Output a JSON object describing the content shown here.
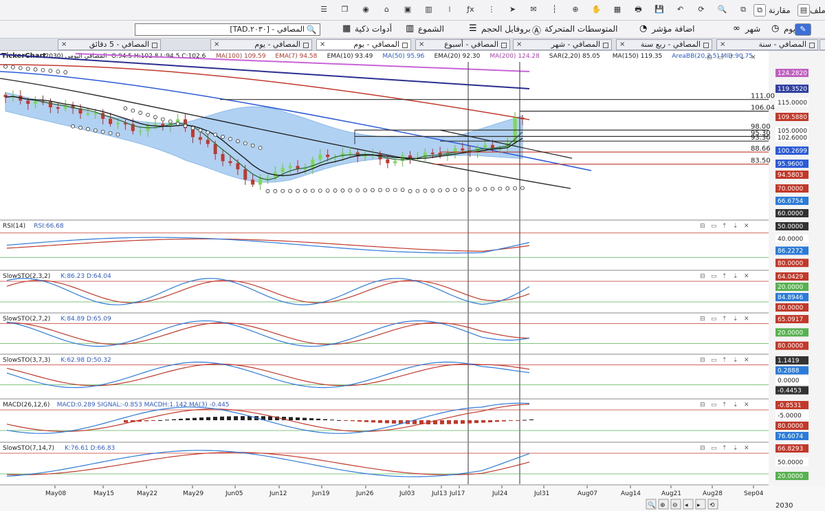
{
  "toolbar1": {
    "right_items": [
      {
        "label": "ملف",
        "icon": "file-icon"
      },
      {
        "label": "مقارنة",
        "icon": "compare-icon"
      }
    ],
    "icon_names": [
      "compare-alt-icon",
      "zoom-icon",
      "refresh-icon",
      "undo-icon",
      "save-icon",
      "print-icon",
      "layout-icon",
      "hand-icon",
      "crosshair-icon",
      "dotted-line-icon",
      "mail-icon",
      "pointer-icon",
      "dots-icon",
      "fx-icon",
      "signal-icon",
      "bar-chart-icon",
      "calendar-icon",
      "home-icon",
      "camera-icon",
      "copy-icon",
      "list-icon"
    ]
  },
  "toolbar2": {
    "items": [
      {
        "label": "يوم",
        "icon": "clock-icon"
      },
      {
        "label": "شهر",
        "icon": "glasses-icon"
      },
      {
        "label": "اضافة مؤشر",
        "icon": "add-indicator-icon"
      },
      {
        "label": "المتوسطات المتحركة",
        "icon": "ma-icon"
      },
      {
        "label": "بروفايل الحجم",
        "icon": "volume-profile-icon"
      },
      {
        "label": "الشموع",
        "icon": "candles-icon"
      },
      {
        "label": "أدوات ذكية",
        "icon": "smart-tools-icon"
      }
    ],
    "search_value": "[TAD.٢٠٣٠] - المصافي"
  },
  "tabs": [
    {
      "label": "المصافي - سنة",
      "active": false
    },
    {
      "label": "المصافي - ربع سنة",
      "active": false
    },
    {
      "label": "المصافي - شهر",
      "active": false
    },
    {
      "label": "المصافي - أسبوع",
      "active": false
    },
    {
      "label": "المصافي - يوم",
      "active": true
    },
    {
      "label": "المصافي - يوم",
      "active": false
    },
    {
      "label": "المصافي - 5 دقائق",
      "active": false
    }
  ],
  "main_header": {
    "title": "TickerChart",
    "symbol": "المصافي اليومي (2030)",
    "ohlc": "O:94.5 H:102.8 L:94.5 C:102.6",
    "indicators": [
      {
        "text": "MA(100)",
        "value": "109.59",
        "color": "#c0392b"
      },
      {
        "text": "EMA(7)",
        "value": "94.58",
        "color": "#c0392b"
      },
      {
        "text": "EMA(10)",
        "value": "93.49",
        "color": "#222222"
      },
      {
        "text": "MA(50)",
        "value": "95.96",
        "color": "#2d5bd8"
      },
      {
        "text": "EMA(20)",
        "value": "92.30",
        "color": "#222222"
      },
      {
        "text": "MA(200)",
        "value": "124.28",
        "color": "#c040c0"
      },
      {
        "text": "SAR(2,20)",
        "value": "85.05",
        "color": "#222222"
      },
      {
        "text": "MA(150)",
        "value": "119.35",
        "color": "#222222"
      },
      {
        "text": "AreaBB(20,2.5)",
        "value": "MID:90.75",
        "color": "#2d5bd8"
      }
    ]
  },
  "level_labels": [
    "111.00",
    "106.04",
    "98.00",
    "95.30",
    "93.30",
    "88.66",
    "83.50"
  ],
  "price_axis": [
    {
      "value": "124.2820",
      "bg": "#c060c0"
    },
    {
      "value": "119.3520",
      "bg": "#3040a0"
    },
    {
      "value": "115.0000",
      "bg": "#ffffff"
    },
    {
      "value": "109.5880",
      "bg": "#c0392b"
    },
    {
      "value": "105.0000",
      "bg": "#ffffff"
    },
    {
      "value": "102.6000",
      "bg": "#ffffff"
    },
    {
      "value": "100.2699",
      "bg": "#2d5bd8"
    },
    {
      "value": "95.9600",
      "bg": "#2d5bd8"
    },
    {
      "value": "94.5803",
      "bg": "#c0392b"
    },
    {
      "value": "70.0000",
      "bg": "#c0392b"
    },
    {
      "value": "66.6754",
      "bg": "#2d7bd8"
    },
    {
      "value": "60.0000",
      "bg": "#333333"
    }
  ],
  "panes": [
    {
      "name": "rsi-pane",
      "label": "RSI(14)",
      "values": "RSI:66.68",
      "axis": [
        {
          "value": "50.0000",
          "bg": "#333333"
        },
        {
          "value": "40.0000",
          "bg": "#ffffff"
        },
        {
          "value": "86.2272",
          "bg": "#2d7bd8"
        },
        {
          "value": "80.0000",
          "bg": "#c0392b"
        }
      ]
    },
    {
      "name": "slowsto-1-pane",
      "label": "SlowSTO(2,3,2)",
      "values": "K:86.23  D:64.04",
      "axis": [
        {
          "value": "64.0429",
          "bg": "#c0392b"
        },
        {
          "value": "20.0000",
          "bg": "#58b050"
        },
        {
          "value": "84.8946",
          "bg": "#2d7bd8"
        },
        {
          "value": "80.0000",
          "bg": "#c0392b"
        }
      ]
    },
    {
      "name": "slowsto-2-pane",
      "label": "SlowSTO(2,7,2)",
      "values": "K:84.89  D:65.09",
      "axis": [
        {
          "value": "65.0917",
          "bg": "#c0392b"
        },
        {
          "value": "20.0000",
          "bg": "#58b050"
        },
        {
          "value": "80.0000",
          "bg": "#c0392b"
        }
      ]
    },
    {
      "name": "slowsto-3-pane",
      "label": "SlowSTO(3,7,3)",
      "values": "K:62.98  D:50.32",
      "axis": [
        {
          "value": "1.1419",
          "bg": "#333333"
        },
        {
          "value": "0.2888",
          "bg": "#2d7bd8"
        },
        {
          "value": "0.0000",
          "bg": "#ffffff"
        },
        {
          "value": "-0.4453",
          "bg": "#333333"
        }
      ]
    },
    {
      "name": "macd-pane",
      "label": "MACD(26,12,6)",
      "values": "MACD:0.289  SIGNAL:-0.853  MACDH:1.142  MA(3) -0.445",
      "axis": [
        {
          "value": "-0.8531",
          "bg": "#c0392b"
        },
        {
          "value": "-5.0000",
          "bg": "#ffffff"
        },
        {
          "value": "80.0000",
          "bg": "#c0392b"
        },
        {
          "value": "76.6074",
          "bg": "#2d7bd8"
        }
      ]
    },
    {
      "name": "slowsto-4-pane",
      "label": "SlowSTO(7,14,7)",
      "values": "K:76.61  D:66.83",
      "axis": [
        {
          "value": "66.8293",
          "bg": "#c0392b"
        },
        {
          "value": "50.0000",
          "bg": "#ffffff"
        },
        {
          "value": "20.0000",
          "bg": "#58b050"
        }
      ]
    }
  ],
  "date_axis": [
    "May08",
    "May15",
    "May22",
    "May29",
    "Jun05",
    "Jun12",
    "Jun19",
    "Jun26",
    "Jul03",
    "Jul13",
    "Jul17",
    "Jul24",
    "Jul31",
    "Aug07",
    "Aug14",
    "Aug21",
    "Aug28",
    "Sep04"
  ],
  "footer_symbol": "2030"
}
